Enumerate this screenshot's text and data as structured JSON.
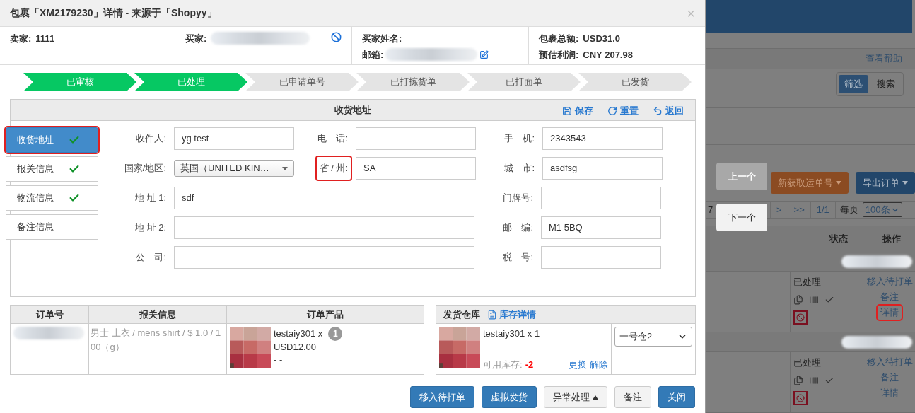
{
  "dialog": {
    "title": "包裹「XM2179230」详情 - 来源于「Shopyy」",
    "close": "×"
  },
  "info": {
    "seller": {
      "label": "卖家:",
      "value": "1111"
    },
    "buyer": {
      "label": "买家:"
    },
    "buyer_name": {
      "label": "买家姓名:"
    },
    "email": {
      "label": "邮箱:"
    },
    "total": {
      "label": "包裹总额:",
      "value": "USD31.0"
    },
    "profit": {
      "label": "预估利润:",
      "value": "CNY 207.98"
    }
  },
  "steps": [
    {
      "label": "已审核",
      "completed": true
    },
    {
      "label": "已处理",
      "completed": true
    },
    {
      "label": "已申请单号",
      "completed": false
    },
    {
      "label": "已打拣货单",
      "completed": false
    },
    {
      "label": "已打面单",
      "completed": false
    },
    {
      "label": "已发货",
      "completed": false
    }
  ],
  "address_panel": {
    "title": "收货地址",
    "actions": [
      "保存",
      "重置",
      "返回"
    ]
  },
  "side_tabs": [
    {
      "label": "收货地址",
      "selected": true,
      "checked": true,
      "annotated": true
    },
    {
      "label": "报关信息",
      "selected": false,
      "checked": true,
      "annotated": false
    },
    {
      "label": "物流信息",
      "selected": false,
      "checked": true,
      "annotated": false
    },
    {
      "label": "备注信息",
      "selected": false,
      "checked": false,
      "annotated": false
    }
  ],
  "form_rows": [
    [
      {
        "label": "收件人:",
        "kind": "text",
        "value": "yg test",
        "annotated": false
      },
      {
        "label": "电　话:",
        "kind": "text",
        "annotated": false
      },
      {
        "label": "手　机:",
        "kind": "text",
        "value": "2343543",
        "annotated": false
      }
    ],
    [
      {
        "label": "国家/地区:",
        "kind": "select",
        "value": "英国（UNITED KIN…",
        "annotated": false
      },
      {
        "label": "省 / 州:",
        "kind": "text",
        "value": "SA",
        "annotated": true
      },
      {
        "label": "城　市:",
        "kind": "text",
        "value": "asdfsg",
        "annotated": false
      }
    ],
    [
      {
        "label": "地 址 1:",
        "kind": "wide",
        "value": "sdf",
        "annotated": false
      },
      {
        "label": "门牌号:",
        "kind": "text",
        "annotated": false
      }
    ],
    [
      {
        "label": "地 址 2:",
        "kind": "wide",
        "annotated": false
      },
      {
        "label": "邮　编:",
        "kind": "text",
        "value": "M1 5BQ",
        "annotated": false
      }
    ],
    [
      {
        "label": "公　司:",
        "kind": "wide",
        "annotated": false
      },
      {
        "label": "税　号:",
        "kind": "text",
        "annotated": false
      }
    ]
  ],
  "order_table": {
    "columns": [
      "订单号",
      "报关信息",
      "订单产品"
    ],
    "customs": "男士 上衣 / mens shirt / $ 1.0 / 100（g）",
    "product": {
      "name": "testaiy301 x",
      "qty": "1",
      "price": "USD12.00",
      "extra": "- -"
    }
  },
  "warehouse": {
    "title": "发货仓库",
    "link": "库存详情",
    "product": "testaiy301 x 1",
    "stock_label": "可用库存:",
    "stock": "-2",
    "links": [
      "更换",
      "解除"
    ],
    "select": "一号仓2"
  },
  "footer_buttons": [
    {
      "label": "移入待打单",
      "kind": "primary"
    },
    {
      "label": "虚拟发货",
      "kind": "primary"
    },
    {
      "label": "异常处理",
      "kind": "dropdown"
    },
    {
      "label": "备注",
      "kind": "default"
    },
    {
      "label": "关闭",
      "kind": "primary"
    }
  ],
  "background_page": {
    "help_link": "查看帮助",
    "filter_tabs": [
      {
        "label": "筛选",
        "selected": true
      },
      {
        "label": "搜索",
        "selected": false
      }
    ],
    "actions": [
      {
        "label": "新获取运单号",
        "kind": "warning"
      },
      {
        "label": "导出订单",
        "kind": "primary"
      }
    ],
    "pagination": {
      "count": "7",
      "pages": [
        ">",
        ">>",
        "1/1"
      ],
      "per_page_label": "每页",
      "per_page": "100条"
    },
    "columns": [
      "状态",
      "操作"
    ],
    "rows": [
      {
        "status": "已处理",
        "links": [
          {
            "label": "移入待打单",
            "annotated": false
          },
          {
            "label": "备注",
            "annotated": false
          },
          {
            "label": "详情",
            "annotated": true
          }
        ]
      },
      {
        "status": "已处理",
        "links": [
          {
            "label": "移入待打单",
            "annotated": false
          },
          {
            "label": "备注",
            "annotated": false
          },
          {
            "label": "详情",
            "annotated": false
          }
        ]
      }
    ]
  },
  "nav_buttons": [
    {
      "label": "上一个",
      "disabled": true
    },
    {
      "label": "下一个",
      "disabled": false
    }
  ]
}
